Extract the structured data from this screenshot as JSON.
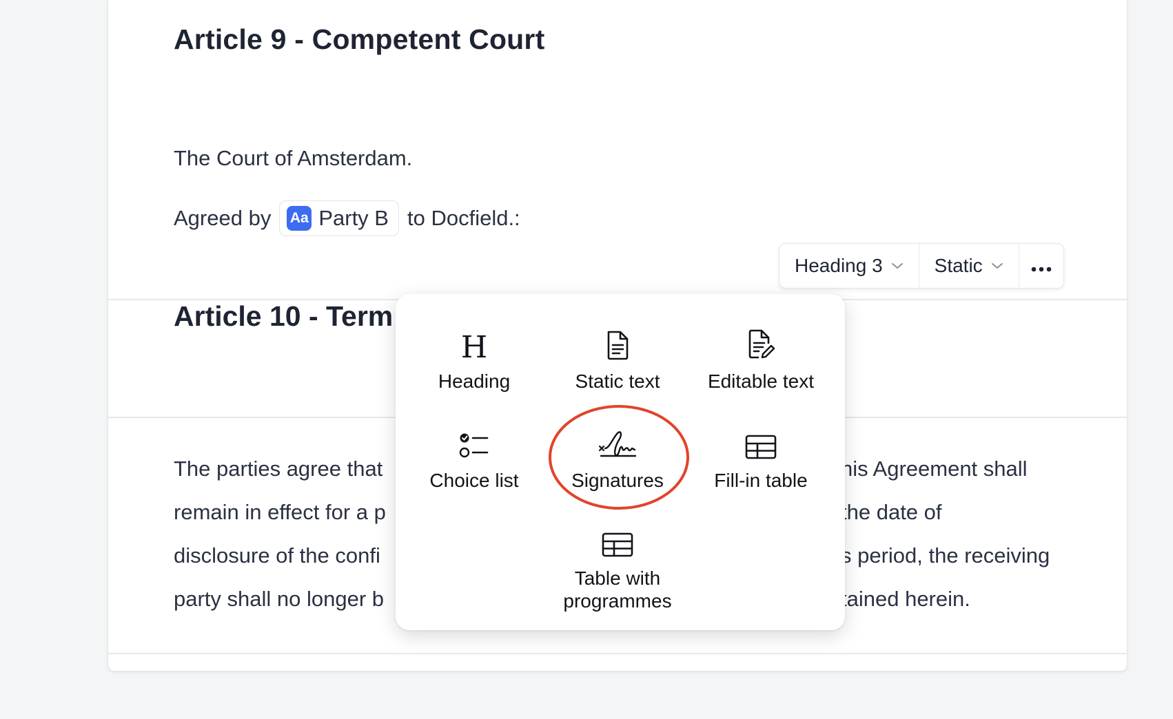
{
  "document": {
    "article9": {
      "heading": "Article 9 - Competent Court",
      "body": "The Court of Amsterdam.",
      "agreed_prefix": "Agreed by",
      "party_chip": {
        "icon_text": "Aa",
        "label": "Party B"
      },
      "agreed_suffix": "to Docfield.:"
    },
    "article10": {
      "heading": "Article 10 - Term (",
      "lines_left": [
        "The parties agree that",
        "remain in effect for a p",
        "disclosure of the confi",
        "party shall no longer b"
      ],
      "lines_right": [
        "his Agreement shall",
        "the date of",
        "s period, the receiving",
        "tained herein."
      ]
    }
  },
  "toolbar": {
    "style_select": "Heading 3",
    "mode_select": "Static",
    "more_icon": "ellipsis-icon"
  },
  "insert_menu": {
    "items": [
      {
        "label": "Heading",
        "icon": "heading-icon"
      },
      {
        "label": "Static text",
        "icon": "document-icon"
      },
      {
        "label": "Editable text",
        "icon": "document-edit-icon"
      },
      {
        "label": "Choice list",
        "icon": "checklist-icon"
      },
      {
        "label": "Signatures",
        "icon": "signature-icon"
      },
      {
        "label": "Fill-in table",
        "icon": "table-icon"
      },
      {
        "label": "Table with programmes",
        "icon": "table-icon"
      }
    ]
  },
  "colors": {
    "accent": "#3d6cf0",
    "highlight_ring": "#e2432b",
    "text": "#1e2433",
    "background": "#f4f5f6"
  }
}
